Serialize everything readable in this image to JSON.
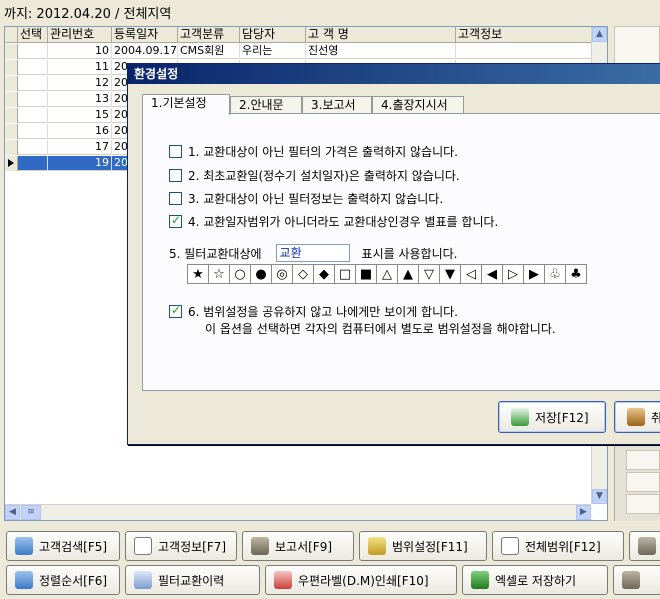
{
  "header": {
    "text": "까지: 2012.04.20 / 전체지역"
  },
  "grid": {
    "columns": [
      "선택",
      "관리번호",
      "등록일자",
      "고객분류",
      "담당자",
      "고 객 명",
      "고객정보"
    ],
    "rows": [
      {
        "num": "10",
        "date": "2004.09.17",
        "cls": "CMS회원",
        "mgr": "우리는",
        "name": "진선영"
      },
      {
        "num": "11",
        "date": "20",
        "cls": "",
        "mgr": "",
        "name": ""
      },
      {
        "num": "12",
        "date": "20",
        "cls": "",
        "mgr": "",
        "name": ""
      },
      {
        "num": "13",
        "date": "20",
        "cls": "",
        "mgr": "",
        "name": ""
      },
      {
        "num": "15",
        "date": "20",
        "cls": "",
        "mgr": "",
        "name": ""
      },
      {
        "num": "16",
        "date": "20",
        "cls": "",
        "mgr": "",
        "name": ""
      },
      {
        "num": "17",
        "date": "20",
        "cls": "",
        "mgr": "",
        "name": ""
      },
      {
        "num": "19",
        "date": "20",
        "cls": "",
        "mgr": "",
        "name": ""
      }
    ]
  },
  "dialog": {
    "title": "환경설정",
    "tabs": [
      "1.기본설정",
      "2.안내문",
      "3.보고서",
      "4.출장지시서"
    ],
    "options": [
      {
        "label": "1. 교환대상이 아닌 필터의 가격은 출력하지 않습니다.",
        "checked": false
      },
      {
        "label": "2. 최초교환일(정수기 설치일자)은 출력하지 않습니다.",
        "checked": false
      },
      {
        "label": "3. 교환대상이 아닌 필터정보는 출력하지 않습니다.",
        "checked": false
      },
      {
        "label": "4. 교환일자범위가 아니더라도 교환대상인경우 별표를 합니다.",
        "checked": true
      }
    ],
    "marker_label": "5. 필터교환대상에",
    "marker_value": "교환",
    "marker_suffix": "표시를 사용합니다.",
    "markers": [
      "★",
      "☆",
      "○",
      "●",
      "◎",
      "◇",
      "◆",
      "□",
      "■",
      "△",
      "▲",
      "▽",
      "▼",
      "◁",
      "◀",
      "▷",
      "▶",
      "♧",
      "♣"
    ],
    "option6_line1": "6. 범위설정을 공유하지 않고 나에게만 보이게 합니다.",
    "option6_line2": "이 옵션을 선택하면 각자의 컴퓨터에서 별도로 범위설정을 해야합니다.",
    "option6_checked": true,
    "save_label": "저장[F12]",
    "cancel_label": "취"
  },
  "toolbar": {
    "row1": [
      "고객검색[F5]",
      "고객정보[F7]",
      "보고서[F9]",
      "범위설정[F11]",
      "전체범위[F12]"
    ],
    "row2": [
      "정렬순서[F6]",
      "필터교환이력",
      "우편라벨(D.M)인쇄[F10]",
      "엑셀로 저장하기"
    ]
  }
}
